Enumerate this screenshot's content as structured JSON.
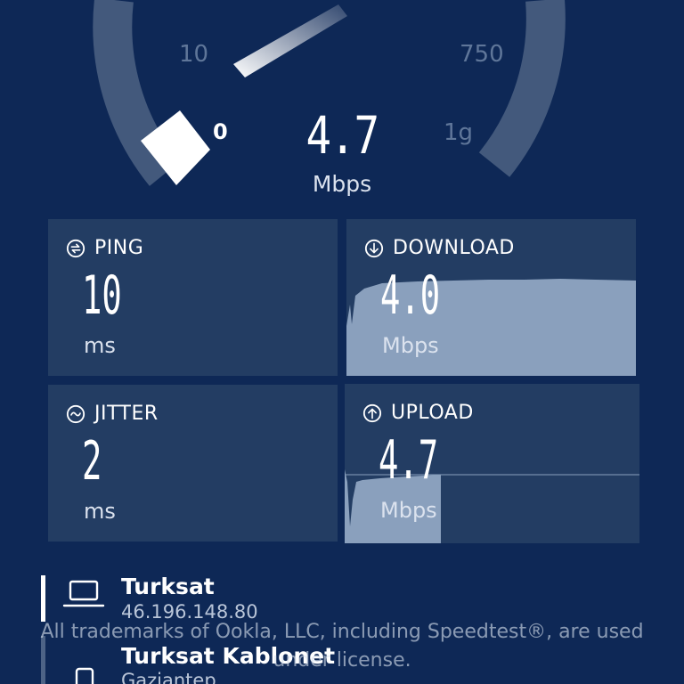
{
  "gauge": {
    "tick_10": "10",
    "tick_750": "750",
    "tick_0": "0",
    "tick_1g": "1g",
    "value": "4.7",
    "unit": "Mbps"
  },
  "metrics": {
    "ping": {
      "label": "PING",
      "value": "10",
      "unit": "ms"
    },
    "download": {
      "label": "DOWNLOAD",
      "value": "4.0",
      "unit": "Mbps"
    },
    "jitter": {
      "label": "JITTER",
      "value": "2",
      "unit": "ms"
    },
    "upload": {
      "label": "UPLOAD",
      "value": "4.7",
      "unit": "Mbps"
    }
  },
  "server": {
    "provider_name": "Turksat",
    "provider_ip": "46.196.148.80",
    "host_name": "Turksat Kablonet",
    "host_location": "Gaziantep"
  },
  "trademark": {
    "line1": "All trademarks of Ookla, LLC, including Speedtest®, are used",
    "line2": "under license."
  },
  "colors": {
    "background": "#0e2856",
    "card": "#233d63",
    "graph_fill": "#8aa0bd",
    "gauge_track": "#43597c"
  }
}
